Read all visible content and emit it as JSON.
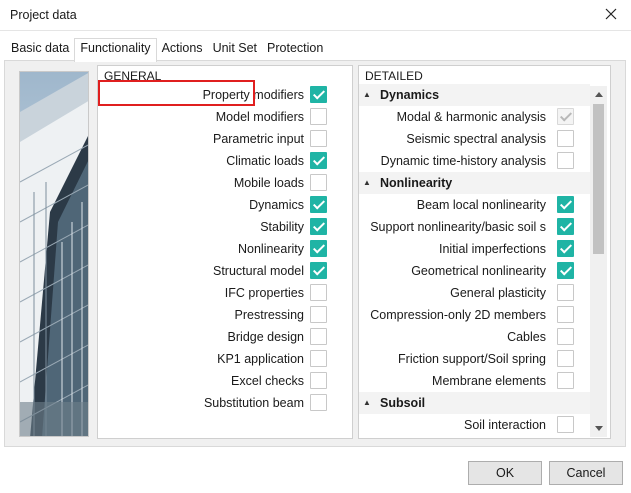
{
  "window": {
    "title": "Project data"
  },
  "tabs": [
    {
      "label": "Basic data",
      "active": false
    },
    {
      "label": "Functionality",
      "active": true
    },
    {
      "label": "Actions",
      "active": false
    },
    {
      "label": "Unit Set",
      "active": false
    },
    {
      "label": "Protection",
      "active": false
    }
  ],
  "general": {
    "header": "GENERAL",
    "items": [
      {
        "label": "Property modifiers",
        "checked": true
      },
      {
        "label": "Model modifiers",
        "checked": false
      },
      {
        "label": "Parametric input",
        "checked": false
      },
      {
        "label": "Climatic loads",
        "checked": true
      },
      {
        "label": "Mobile loads",
        "checked": false
      },
      {
        "label": "Dynamics",
        "checked": true
      },
      {
        "label": "Stability",
        "checked": true
      },
      {
        "label": "Nonlinearity",
        "checked": true
      },
      {
        "label": "Structural model",
        "checked": true
      },
      {
        "label": "IFC properties",
        "checked": false
      },
      {
        "label": "Prestressing",
        "checked": false
      },
      {
        "label": "Bridge design",
        "checked": false
      },
      {
        "label": "KP1 application",
        "checked": false
      },
      {
        "label": "Excel checks",
        "checked": false
      },
      {
        "label": "Substitution beam",
        "checked": false
      }
    ]
  },
  "detailed": {
    "header": "DETAILED",
    "sections": [
      {
        "name": "Dynamics",
        "items": [
          {
            "label": "Modal & harmonic analysis",
            "state": "disabled"
          },
          {
            "label": "Seismic spectral analysis",
            "state": "off"
          },
          {
            "label": "Dynamic time-history analysis",
            "state": "off"
          }
        ]
      },
      {
        "name": "Nonlinearity",
        "items": [
          {
            "label": "Beam local nonlinearity",
            "state": "on"
          },
          {
            "label": "Support nonlinearity/basic soil s",
            "state": "on"
          },
          {
            "label": "Initial imperfections",
            "state": "on"
          },
          {
            "label": "Geometrical nonlinearity",
            "state": "on"
          },
          {
            "label": "General plasticity",
            "state": "off"
          },
          {
            "label": "Compression-only 2D members",
            "state": "off"
          },
          {
            "label": "Cables",
            "state": "off"
          },
          {
            "label": "Friction support/Soil spring",
            "state": "off"
          },
          {
            "label": "Membrane elements",
            "state": "off"
          }
        ]
      },
      {
        "name": "Subsoil",
        "items": [
          {
            "label": "Soil interaction",
            "state": "off"
          }
        ]
      }
    ]
  },
  "buttons": {
    "ok": "OK",
    "cancel": "Cancel"
  }
}
